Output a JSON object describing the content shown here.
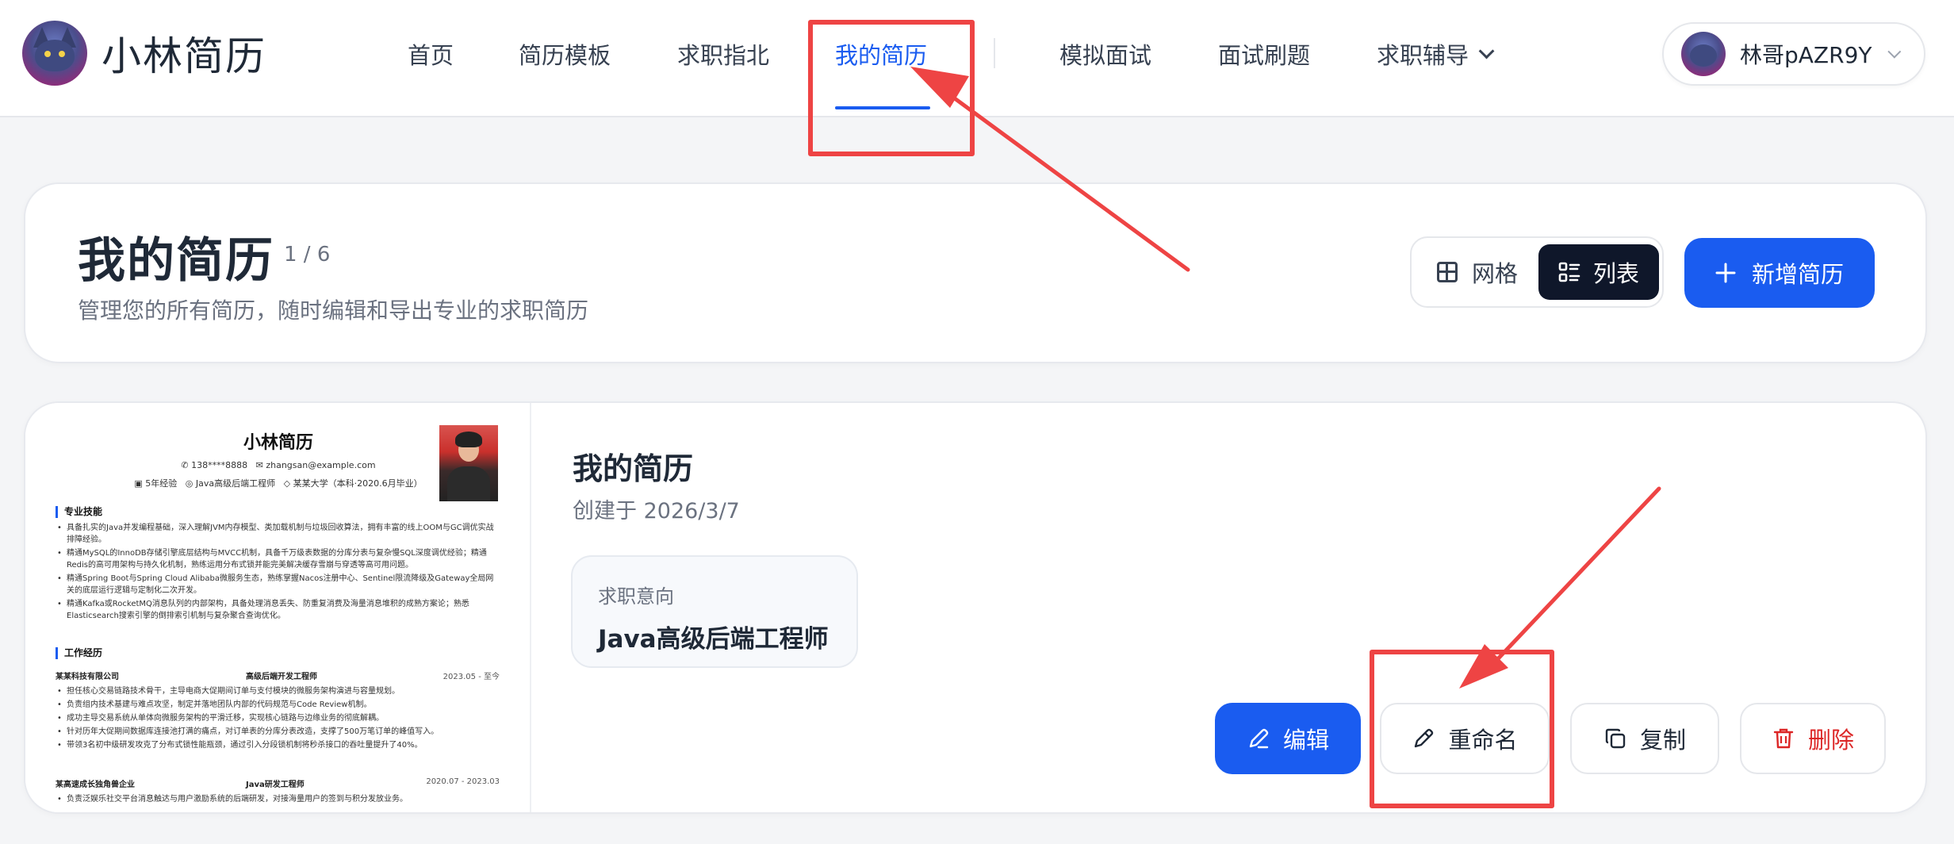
{
  "brand": {
    "name": "小林简历"
  },
  "nav": {
    "items": [
      {
        "label": "首页"
      },
      {
        "label": "简历模板"
      },
      {
        "label": "求职指北"
      },
      {
        "label": "我的简历"
      },
      {
        "label": "模拟面试"
      },
      {
        "label": "面试刷题"
      },
      {
        "label": "求职辅导"
      }
    ],
    "active": "我的简历"
  },
  "user": {
    "name": "林哥pAZR9Y"
  },
  "header": {
    "title": "我的简历",
    "count": "1 / 6",
    "subtitle": "管理您的所有简历，随时编辑和导出专业的求职简历",
    "view_grid_label": "网格",
    "view_list_label": "列表",
    "view_selected": "列表",
    "add_button_label": "新增简历"
  },
  "resume": {
    "title": "我的简历",
    "created": "创建于 2026/3/7",
    "intent_label": "求职意向",
    "intent_value": "Java高级后端工程师",
    "actions": {
      "edit": "编辑",
      "rename": "重命名",
      "copy": "复制",
      "delete": "删除"
    }
  },
  "preview": {
    "name": "小林简历",
    "phone": "138****8888",
    "email": "zhangsan@example.com",
    "experience": "5年经验",
    "position": "Java高级后端工程师",
    "education": "某某大学（本科·2020.6月毕业）",
    "skills_title": "专业技能",
    "skills": [
      "具备扎实的Java并发编程基础，深入理解JVM内存模型、类加载机制与垃圾回收算法，拥有丰富的线上OOM与GC调优实战排障经验。",
      "精通MySQL的InnoDB存储引擎底层结构与MVCC机制，具备千万级表数据的分库分表与复杂慢SQL深度调优经验；精通Redis的高可用架构与持久化机制，熟练运用分布式锁并能完美解决缓存雪崩与穿透等高可用问题。",
      "精通Spring Boot与Spring Cloud Alibaba微服务生态，熟练掌握Nacos注册中心、Sentinel限流降级及Gateway全局网关的底层运行逻辑与定制化二次开发。",
      "精通Kafka或RocketMQ消息队列的内部架构，具备处理消息丢失、防重复消费及海量消息堆积的成熟方案论；熟悉Elasticsearch搜索引擎的倒排索引机制与复杂聚合查询优化。"
    ],
    "work_title": "工作经历",
    "jobs": [
      {
        "company": "某某科技有限公司",
        "role": "高级后端开发工程师",
        "period": "2023.05 - 至今",
        "bullets": [
          "担任核心交易链路技术骨干，主导电商大促期间订单与支付模块的微服务架构演进与容量规划。",
          "负责组内技术基建与难点攻坚，制定并落地团队内部的代码规范与Code Review机制。",
          "成功主导交易系统从单体向微服务架构的平滑迁移，实现核心链路与边缘业务的彻底解耦。",
          "针对历年大促期间数据库连接池打满的痛点，对订单表的分库分表改造，支撑了500万笔订单的峰值写入。",
          "带领3名初中级研发攻克了分布式锁性能瓶颈，通过引入分段锁机制将秒杀接口的吞吐量提升了40%。"
        ]
      },
      {
        "company": "某高速成长独角兽企业",
        "role": "Java研发工程师",
        "period": "2020.07 - 2023.03",
        "bullets": [
          "负责泛娱乐社交平台消息触达与用户激励系统的后端研发，对接海量用户的签到与积分发放业务。"
        ]
      }
    ]
  },
  "colors": {
    "accent": "#1a5cf0",
    "dark_toggle": "#0f172a",
    "danger": "#dc2626",
    "annotation": "#ee4444"
  },
  "icons": {
    "grid": "grid-icon",
    "list": "list-icon",
    "plus": "plus-icon",
    "edit": "pen-icon",
    "rename": "pencil-icon",
    "copy": "copy-icon",
    "delete": "trash-icon",
    "chevron": "chevron-down-icon"
  }
}
